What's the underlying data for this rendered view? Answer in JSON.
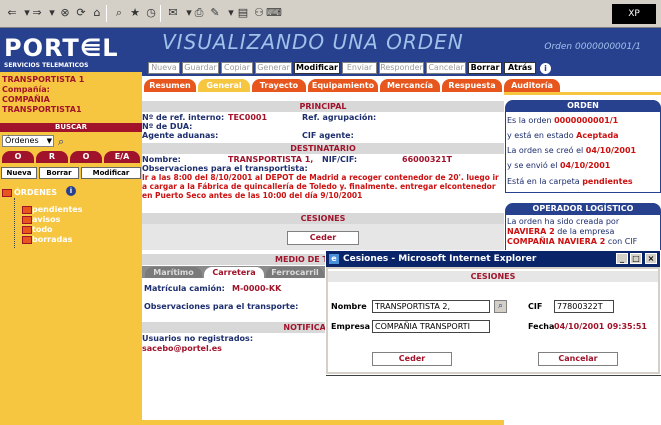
{
  "browser": {
    "win_logo": "XP"
  },
  "sidebar": {
    "logo_text": "PORT⋹L",
    "logo_sub": "SERVICIOS TELEMATICOS",
    "user_line1": "TRANSPORTISTA 1",
    "user_line2": "Compañía:",
    "user_line3": "COMPAÑIA",
    "user_line4": "TRANSPORTISTA1",
    "buscar": "BUSCAR",
    "select_value": "Órdenes",
    "tabs": [
      "O",
      "R",
      "O",
      "E/A"
    ],
    "buttons": [
      "Nueva",
      "Borrar",
      "Modificar"
    ],
    "ordenes_label": "ÓRDENES",
    "tree": [
      "pendientes",
      "avisos",
      "todo",
      "borradas"
    ]
  },
  "header": {
    "title": "VISUALIZANDO UNA ORDEN",
    "order_id": "Orden 0000000001/1"
  },
  "actions": {
    "buttons": [
      {
        "label": "Nueva",
        "enabled": false
      },
      {
        "label": "Guardar",
        "enabled": false
      },
      {
        "label": "Copiar",
        "enabled": false
      },
      {
        "label": "Generar",
        "enabled": false
      },
      {
        "label": "Modificar",
        "enabled": true
      },
      {
        "label": "Enviar",
        "enabled": false
      },
      {
        "label": "Responder",
        "enabled": false
      },
      {
        "label": "Cancelar",
        "enabled": false
      },
      {
        "label": "Borrar",
        "enabled": true
      },
      {
        "label": "Atrás",
        "enabled": true
      }
    ]
  },
  "tabs": [
    "Resumen",
    "General",
    "Trayecto",
    "Equipamiento",
    "Mercancía",
    "Respuesta",
    "Auditoría"
  ],
  "principal": {
    "header": "PRINCIPAL",
    "ref_label": "Nº de ref. interno:",
    "ref_value": "TEC0001",
    "agrup_label": "Ref. agrupación:",
    "dua_label": "Nº de DUA:",
    "agente_label": "Agente aduanas:",
    "cif_agente_label": "CIF agente:"
  },
  "destinatario": {
    "header": "DESTINATARIO",
    "nombre_label": "Nombre:",
    "nombre_value": "TRANSPORTISTA 1,",
    "nif_label": "NIF/CIF:",
    "nif_value": "66000321T",
    "obs_label": "Observaciones para el transportista:",
    "obs_text": "Ir a las 8:00 del 8/10/2001 al DEPOT de Madrid a recoger contenedor de 20'. luego ir a cargar a la Fábrica de quincallería de Toledo y. finalmente. entregar elcontenedor en Puerto Seco antes de las 10:00 del día 9/10/2001"
  },
  "cesiones": {
    "header": "CESIONES",
    "button": "Ceder"
  },
  "medio": {
    "header": "MEDIO DE T",
    "tabs": [
      "Marítimo",
      "Carretera",
      "Ferrocarril"
    ],
    "matricula_label": "Matrícula camión:",
    "matricula_value": "M-0000-KK",
    "obs_label": "Observaciones para el transporte:"
  },
  "notificar": {
    "header": "NOTIFICAR",
    "usuarios_label": "Usuarios no registrados:",
    "email": "sacebo@portel.es"
  },
  "right": {
    "orden_header": "ORDEN",
    "l1_pre": "Es la orden ",
    "l1_b": "0000000001/1",
    "l2_pre": "y está en estado ",
    "l2_b": "Aceptada",
    "l3_pre": "La orden se creó el ",
    "l3_b": "04/10/2001",
    "l4_pre": "y se envió el ",
    "l4_b": "04/10/2001",
    "l5_pre": "Está en la carpeta ",
    "l5_b": "pendientes",
    "op_header": "OPERADOR LOGÍSTICO",
    "op1": "La orden ha sido creada por",
    "op2_b": "NAVIERA 2",
    "op2_post": " de la empresa",
    "op3_b": "COMPAÑIA NAVIERA 2",
    "op3_post": " con CIF"
  },
  "dialog": {
    "title": "Cesiones - Microsoft Internet Explorer",
    "header": "CESIONES",
    "nombre_label": "Nombre",
    "nombre_value": "TRANSPORTISTA 2,",
    "cif_label": "CIF",
    "cif_value": "77800322T",
    "empresa_label": "Empresa",
    "empresa_value": "COMPAÑIA TRANSPORTI",
    "fecha_label": "Fecha",
    "fecha_value": "04/10/2001 09:35:51",
    "ceder": "Ceder",
    "cancelar": "Cancelar"
  }
}
